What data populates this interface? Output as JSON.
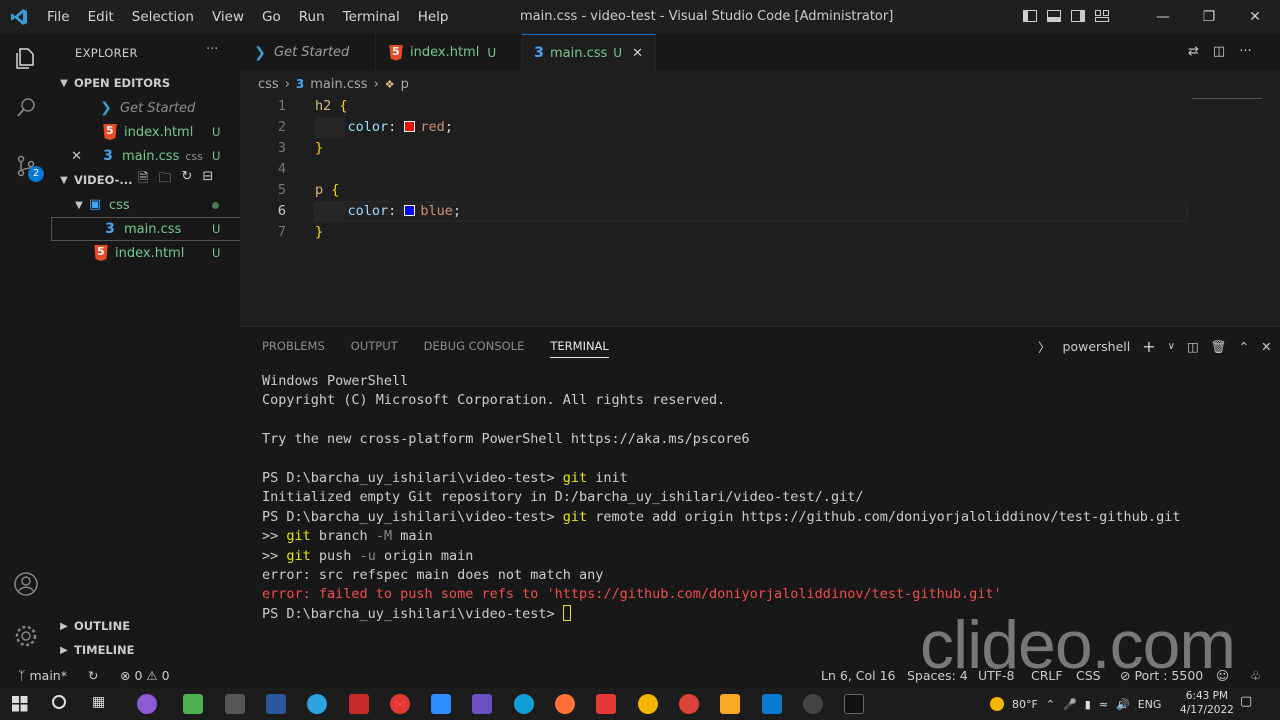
{
  "titlebar": {
    "menu": [
      "File",
      "Edit",
      "Selection",
      "View",
      "Go",
      "Run",
      "Terminal",
      "Help"
    ],
    "window_title": "main.css - video-test - Visual Studio Code [Administrator]"
  },
  "activity": {
    "scm_badge": "2"
  },
  "sidebar": {
    "header": "EXPLORER",
    "open_editors_title": "OPEN EDITORS",
    "open_editors": [
      {
        "name": "Get Started",
        "status": ""
      },
      {
        "name": "index.html",
        "status": "U"
      },
      {
        "name": "main.css",
        "hint": "css",
        "status": "U"
      }
    ],
    "folder_title": "VIDEO-...",
    "tree": [
      {
        "name": "css",
        "status": ""
      },
      {
        "name": "main.css",
        "status": "U"
      },
      {
        "name": "index.html",
        "status": "U"
      }
    ],
    "outline": "OUTLINE",
    "timeline": "TIMELINE"
  },
  "tabs": [
    {
      "label": "Get Started",
      "status": ""
    },
    {
      "label": "index.html",
      "status": "U"
    },
    {
      "label": "main.css",
      "status": "U"
    }
  ],
  "breadcrumb": {
    "folder": "css",
    "file": "main.css",
    "symbol": "p"
  },
  "editor": {
    "lines": [
      {
        "n": "1",
        "sel": "h2",
        "brace": "{"
      },
      {
        "n": "2",
        "prop": "color",
        "val": "red",
        "swatch": "#e51400"
      },
      {
        "n": "3",
        "brace": "}"
      },
      {
        "n": "4"
      },
      {
        "n": "5",
        "sel": "p",
        "brace": "{"
      },
      {
        "n": "6",
        "prop": "color",
        "val": "blue",
        "swatch": "#0000ff"
      },
      {
        "n": "7",
        "brace": "}"
      }
    ]
  },
  "panel": {
    "tabs": [
      "PROBLEMS",
      "OUTPUT",
      "DEBUG CONSOLE",
      "TERMINAL"
    ],
    "shell": "powershell",
    "terminal": {
      "l1": "Windows PowerShell",
      "l2": "Copyright (C) Microsoft Corporation. All rights reserved.",
      "l3": "Try the new cross-platform PowerShell https://aka.ms/pscore6",
      "prompt": "PS D:\\barcha_uy_ishilari\\video-test> ",
      "git": "git",
      "cmd1": " init",
      "l5": "Initialized empty Git repository in D:/barcha_uy_ishilari/video-test/.git/",
      "cmd2": " remote add origin https://github.com/doniyorjaloliddinov/test-github.git",
      "cont": ">> ",
      "cmd3a": " branch ",
      "cmd3flag": "-M",
      "cmd3b": " main",
      "cmd4a": " push ",
      "cmd4flag": "-u",
      "cmd4b": " origin main",
      "l9": "error: src refspec main does not match any",
      "l10": "error: failed to push some refs to 'https://github.com/doniyorjaloliddinov/test-github.git'"
    }
  },
  "statusbar": {
    "branch": "main*",
    "errors": "0",
    "warnings": "0",
    "position": "Ln 6, Col 16",
    "spaces": "Spaces: 4",
    "encoding": "UTF-8",
    "eol": "CRLF",
    "language": "CSS",
    "port": "Port : 5500"
  },
  "watermark": "clideo.com",
  "taskbar": {
    "weather": "80°F",
    "lang": "ENG",
    "time": "6:43 PM",
    "date": "4/17/2022"
  }
}
